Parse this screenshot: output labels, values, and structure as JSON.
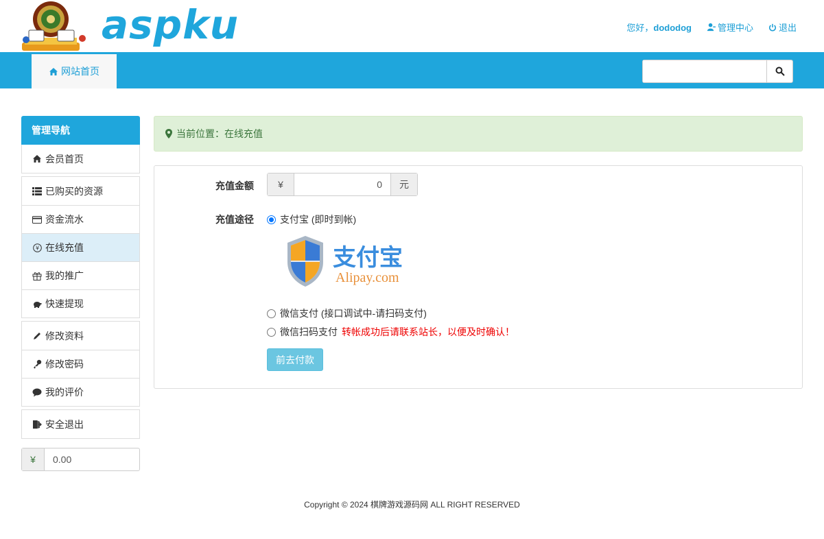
{
  "header": {
    "logo_text": "aspku",
    "greeting": "您好，",
    "username": "dododog",
    "admin_center": "管理中心",
    "logout": "退出"
  },
  "nav": {
    "home_label": "网站首页",
    "search_placeholder": ""
  },
  "sidebar": {
    "title": "管理导航",
    "groups": [
      [
        {
          "label": "会员首页",
          "icon": "home-icon"
        }
      ],
      [
        {
          "label": "已购买的资源",
          "icon": "list-icon"
        },
        {
          "label": "资金流水",
          "icon": "credit-card-icon"
        },
        {
          "label": "在线充值",
          "icon": "yen-circle-icon",
          "active": true
        },
        {
          "label": "我的推广",
          "icon": "gift-icon"
        },
        {
          "label": "快速提现",
          "icon": "piggy-bank-icon"
        }
      ],
      [
        {
          "label": "修改资料",
          "icon": "pencil-icon"
        },
        {
          "label": "修改密码",
          "icon": "key-icon"
        },
        {
          "label": "我的评价",
          "icon": "comment-icon"
        }
      ],
      [
        {
          "label": "安全退出",
          "icon": "logout-icon"
        }
      ]
    ],
    "balance_symbol": "¥",
    "balance_value": "0.00"
  },
  "main": {
    "breadcrumb": "当前位置：在线充值",
    "amount_label": "充值金额",
    "amount_prefix": "¥",
    "amount_value": "0",
    "amount_suffix": "元",
    "method_label": "充值途径",
    "options": {
      "alipay": "支付宝 (即时到帐)",
      "wechat": "微信支付 (接口调试中-请扫码支付)",
      "wechat_scan": "微信扫码支付",
      "wechat_scan_note": "转帐成功后请联系站长，以便及时确认！"
    },
    "alipay_logo_cn": "支付宝",
    "alipay_logo_en": "Alipay.com",
    "submit": "前去付款"
  },
  "footer": {
    "copyright": "Copyright © 2024 棋牌游戏源码网 ALL RIGHT RESERVED"
  },
  "colors": {
    "brand": "#1fa6dc",
    "success_bg": "#dff0d8",
    "success_text": "#3c763d",
    "button": "#5bc0de",
    "warning": "#e00000"
  }
}
